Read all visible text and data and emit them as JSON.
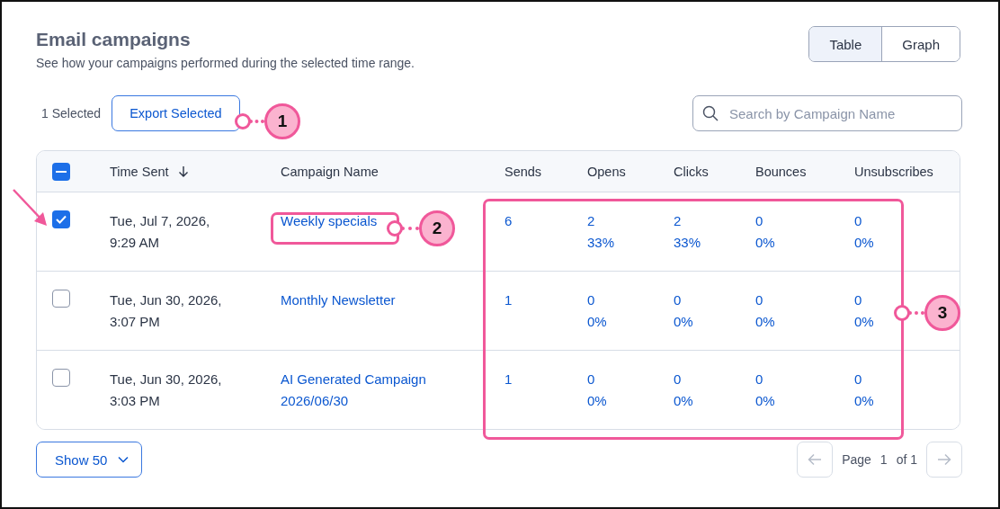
{
  "header": {
    "title": "Email campaigns",
    "subtitle": "See how your campaigns performed during the selected time range."
  },
  "view_toggle": [
    {
      "label": "Table",
      "selected": true
    },
    {
      "label": "Graph",
      "selected": false
    }
  ],
  "toolbar": {
    "selected_count": "1 Selected",
    "export_button": "Export Selected",
    "search": {
      "placeholder": "Search by Campaign Name"
    }
  },
  "table": {
    "header_checkbox": {
      "partial": true
    },
    "columns": [
      {
        "label": "Time Sent",
        "sorted": true
      },
      {
        "label": "Campaign Name",
        "sorted": false
      },
      {
        "label": "Sends",
        "sorted": false
      },
      {
        "label": "Opens",
        "sorted": false
      },
      {
        "label": "Clicks",
        "sorted": false
      },
      {
        "label": "Bounces",
        "sorted": false
      },
      {
        "label": "Unsubscribes",
        "sorted": false
      }
    ],
    "rows": [
      {
        "checked": true,
        "time_sent": "Tue, Jul 7, 2026, 9:29 AM",
        "campaign": "Weekly specials",
        "sends": "6",
        "metrics": [
          {
            "count": "2",
            "percent": "33%"
          },
          {
            "count": "2",
            "percent": "33%"
          },
          {
            "count": "0",
            "percent": "0%"
          },
          {
            "count": "0",
            "percent": "0%"
          }
        ]
      },
      {
        "checked": false,
        "time_sent": "Tue, Jun 30, 2026, 3:07 PM",
        "campaign": "Monthly Newsletter",
        "sends": "1",
        "metrics": [
          {
            "count": "0",
            "percent": "0%"
          },
          {
            "count": "0",
            "percent": "0%"
          },
          {
            "count": "0",
            "percent": "0%"
          },
          {
            "count": "0",
            "percent": "0%"
          }
        ]
      },
      {
        "checked": false,
        "time_sent": "Tue, Jun 30, 2026, 3:03 PM",
        "campaign": "AI Generated Campaign 2026/06/30",
        "sends": "1",
        "metrics": [
          {
            "count": "0",
            "percent": "0%"
          },
          {
            "count": "0",
            "percent": "0%"
          },
          {
            "count": "0",
            "percent": "0%"
          },
          {
            "count": "0",
            "percent": "0%"
          }
        ]
      }
    ]
  },
  "footer": {
    "page_size": "Show 50",
    "pagination": {
      "page_label": "Page",
      "page": "1",
      "of": "of 1",
      "prev_disabled": true,
      "next_disabled": true
    }
  },
  "annotations": [
    {
      "kind": "arrow"
    },
    {
      "kind": "callout",
      "label": "1"
    },
    {
      "kind": "boxed_callout",
      "label": "2"
    },
    {
      "kind": "boxed_callout",
      "label": "3"
    }
  ]
}
